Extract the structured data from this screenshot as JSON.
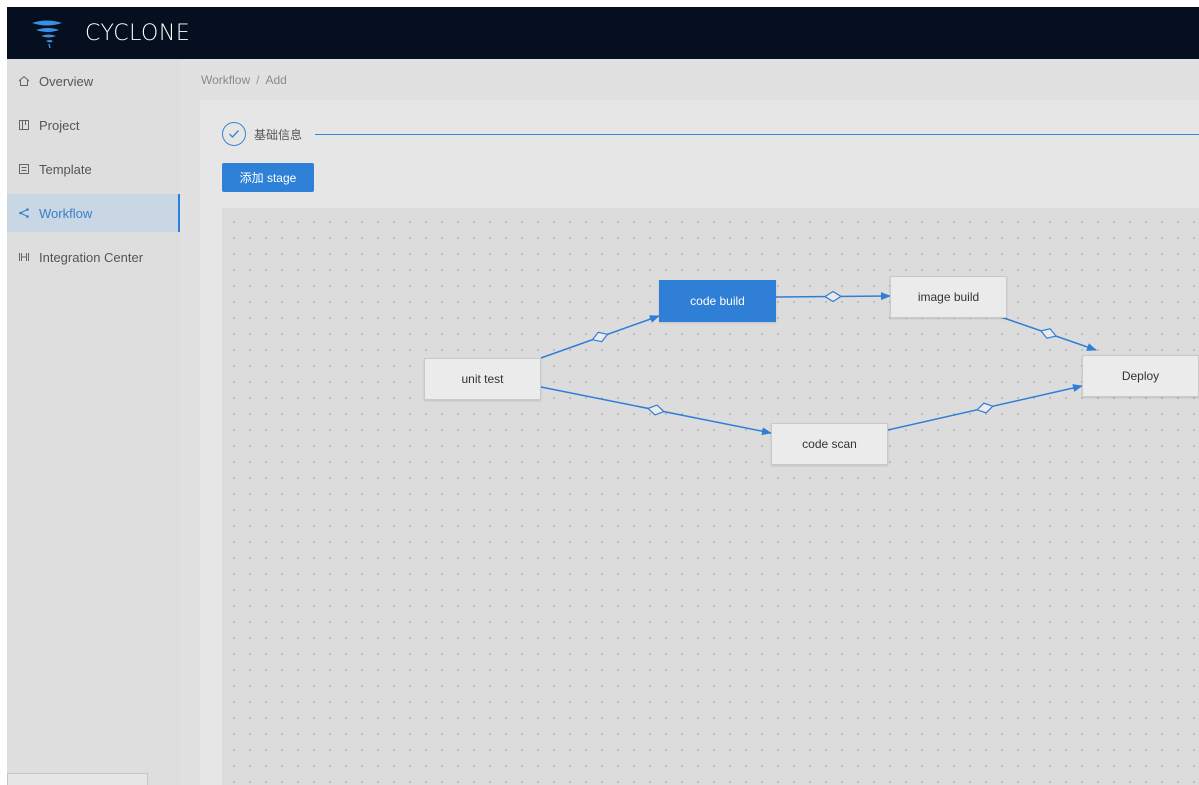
{
  "app": {
    "title": "CYCLONE"
  },
  "sidebar": {
    "items": [
      {
        "label": "Overview",
        "icon": "home-icon"
      },
      {
        "label": "Project",
        "icon": "project-icon"
      },
      {
        "label": "Template",
        "icon": "template-icon"
      },
      {
        "label": "Workflow",
        "icon": "share-icon",
        "active": true
      },
      {
        "label": "Integration Center",
        "icon": "integration-icon"
      }
    ]
  },
  "breadcrumb": {
    "items": [
      "Workflow",
      "Add"
    ],
    "separator": "/"
  },
  "steps": [
    {
      "label": "基础信息",
      "status": "done"
    }
  ],
  "toolbar": {
    "add_stage_label": "添加 stage"
  },
  "workflow": {
    "nodes": [
      {
        "id": "unit-test",
        "label": "unit test"
      },
      {
        "id": "code-build",
        "label": "code build",
        "selected": true
      },
      {
        "id": "image-build",
        "label": "image build"
      },
      {
        "id": "code-scan",
        "label": "code scan"
      },
      {
        "id": "deploy",
        "label": "Deploy"
      }
    ],
    "edges": [
      {
        "from": "unit-test",
        "to": "code-build"
      },
      {
        "from": "code-build",
        "to": "image-build"
      },
      {
        "from": "image-build",
        "to": "deploy"
      },
      {
        "from": "unit-test",
        "to": "code-scan"
      },
      {
        "from": "code-scan",
        "to": "deploy"
      }
    ]
  },
  "colors": {
    "accent": "#2f7fd6",
    "topbar": "#060f1f",
    "sidebar": "#dedede",
    "canvas": "#dcdcdc"
  }
}
